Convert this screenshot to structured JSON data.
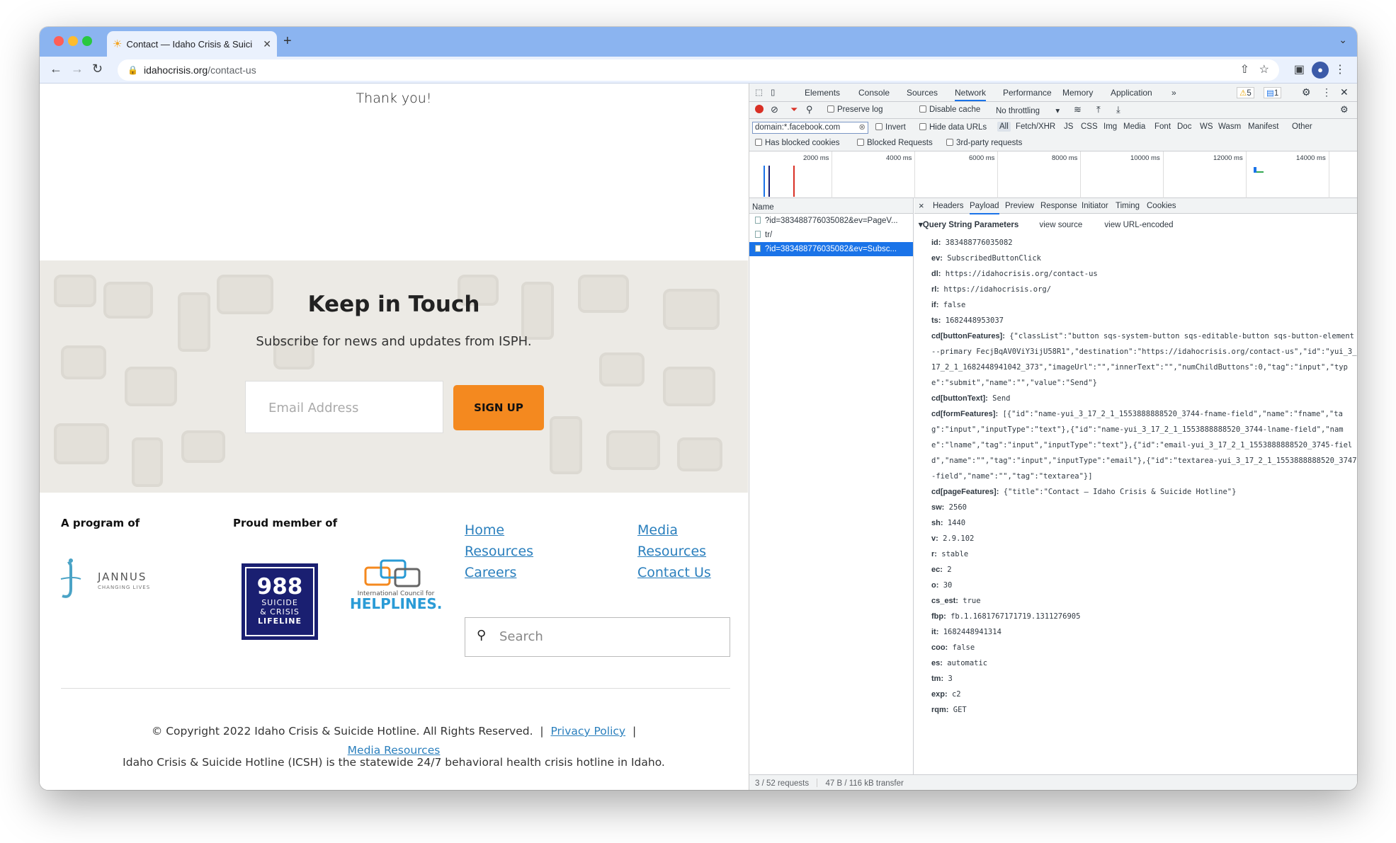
{
  "browser": {
    "tab_title": "Contact — Idaho Crisis & Suici",
    "url_host": "idahocrisis.org",
    "url_path": "/contact-us"
  },
  "page": {
    "thank_you": "Thank you!",
    "newsletter": {
      "heading": "Keep in Touch",
      "subheading": "Subscribe for news and updates from ISPH.",
      "email_placeholder": "Email Address",
      "signup_label": "SIGN UP"
    },
    "footer": {
      "program_heading": "A program of",
      "member_heading": "Proud member of",
      "jannus_name": "JANNUS",
      "jannus_tag": "CHANGING LIVES",
      "lifeline_number": "988",
      "lifeline_line1": "SUICIDE",
      "lifeline_line2": "& CRISIS",
      "lifeline_line3": "LIFELINE",
      "helplines_small": "International Council for",
      "helplines_big": "HELPLINES.",
      "links": {
        "home": "Home",
        "resources1": "Resources",
        "careers": "Careers",
        "media": "Media",
        "resources2": "Resources",
        "contact": "Contact Us"
      },
      "search_placeholder": "Search",
      "copyright": "© Copyright 2022 Idaho Crisis & Suicide Hotline. All Rights Reserved.",
      "sep": "|",
      "privacy": "Privacy Policy",
      "media_resources": "Media Resources",
      "about": "Idaho Crisis & Suicide Hotline (ICSH) is the statewide 24/7 behavioral health crisis hotline in Idaho."
    }
  },
  "devtools": {
    "tabs": {
      "elements": "Elements",
      "console": "Console",
      "sources": "Sources",
      "network": "Network",
      "performance": "Performance",
      "memory": "Memory",
      "application": "Application",
      "more": "»"
    },
    "warnings": "5",
    "messages": "1",
    "preserve_log": "Preserve log",
    "disable_cache": "Disable cache",
    "throttling": "No throttling",
    "filter_value": "domain:*.facebook.com",
    "invert": "Invert",
    "hide_data_urls": "Hide data URLs",
    "types": {
      "all": "All",
      "fetch": "Fetch/XHR",
      "js": "JS",
      "css": "CSS",
      "img": "Img",
      "media": "Media",
      "font": "Font",
      "doc": "Doc",
      "ws": "WS",
      "wasm": "Wasm",
      "manifest": "Manifest",
      "other": "Other"
    },
    "has_blocked_cookies": "Has blocked cookies",
    "blocked_requests": "Blocked Requests",
    "third_party": "3rd-party requests",
    "timeline_ticks": [
      "2000 ms",
      "4000 ms",
      "6000 ms",
      "8000 ms",
      "10000 ms",
      "12000 ms",
      "14000 ms"
    ],
    "name_header": "Name",
    "requests": [
      "?id=383488776035082&ev=PageV...",
      "tr/",
      "?id=383488776035082&ev=Subsc..."
    ],
    "status_requests": "3 / 52 requests",
    "status_transfer": "47 B / 116 kB transfer",
    "detail_tabs": {
      "close": "×",
      "headers": "Headers",
      "payload": "Payload",
      "preview": "Preview",
      "response": "Response",
      "initiator": "Initiator",
      "timing": "Timing",
      "cookies": "Cookies"
    },
    "qsp_title": "Query String Parameters",
    "view_source": "view source",
    "view_encoded": "view URL-encoded",
    "params": [
      {
        "k": "id:",
        "v": "383488776035082"
      },
      {
        "k": "ev:",
        "v": "SubscribedButtonClick"
      },
      {
        "k": "dl:",
        "v": "https://idahocrisis.org/contact-us"
      },
      {
        "k": "rl:",
        "v": "https://idahocrisis.org/"
      },
      {
        "k": "if:",
        "v": "false"
      },
      {
        "k": "ts:",
        "v": "1682448953037"
      },
      {
        "k": "cd[buttonFeatures]:",
        "v": "{\"classList\":\"button sqs-system-button sqs-editable-button sqs-button-element--primary FecjBqAV0ViY3ijU58R1\",\"destination\":\"https://idahocrisis.org/contact-us\",\"id\":\"yui_3_17_2_1_1682448941042_373\",\"imageUrl\":\"\",\"innerText\":\"\",\"numChildButtons\":0,\"tag\":\"input\",\"type\":\"submit\",\"name\":\"\",\"value\":\"Send\"}"
      },
      {
        "k": "cd[buttonText]:",
        "v": "Send"
      },
      {
        "k": "cd[formFeatures]:",
        "v": "[{\"id\":\"name-yui_3_17_2_1_1553888888520_3744-fname-field\",\"name\":\"fname\",\"tag\":\"input\",\"inputType\":\"text\"},{\"id\":\"name-yui_3_17_2_1_1553888888520_3744-lname-field\",\"name\":\"lname\",\"tag\":\"input\",\"inputType\":\"text\"},{\"id\":\"email-yui_3_17_2_1_1553888888520_3745-field\",\"name\":\"\",\"tag\":\"input\",\"inputType\":\"email\"},{\"id\":\"textarea-yui_3_17_2_1_1553888888520_3747-field\",\"name\":\"\",\"tag\":\"textarea\"}]"
      },
      {
        "k": "cd[pageFeatures]:",
        "v": "{\"title\":\"Contact — Idaho Crisis & Suicide Hotline\"}"
      },
      {
        "k": "sw:",
        "v": "2560"
      },
      {
        "k": "sh:",
        "v": "1440"
      },
      {
        "k": "v:",
        "v": "2.9.102"
      },
      {
        "k": "r:",
        "v": "stable"
      },
      {
        "k": "ec:",
        "v": "2"
      },
      {
        "k": "o:",
        "v": "30"
      },
      {
        "k": "cs_est:",
        "v": "true"
      },
      {
        "k": "fbp:",
        "v": "fb.1.1681767171719.1311276905"
      },
      {
        "k": "it:",
        "v": "1682448941314"
      },
      {
        "k": "coo:",
        "v": "false"
      },
      {
        "k": "es:",
        "v": "automatic"
      },
      {
        "k": "tm:",
        "v": "3"
      },
      {
        "k": "exp:",
        "v": "c2"
      },
      {
        "k": "rqm:",
        "v": "GET"
      }
    ]
  },
  "colors": {
    "accent_orange": "#f4891f",
    "link_blue": "#2a7fbd",
    "devtools_blue": "#1a73e8"
  }
}
